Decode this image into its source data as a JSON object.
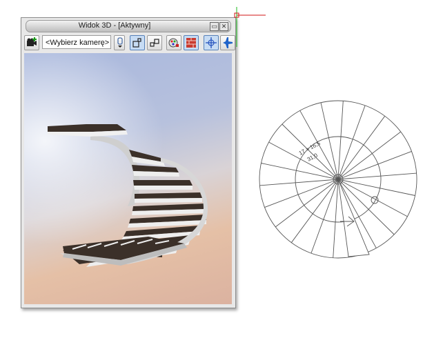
{
  "window": {
    "title": "Widok 3D - [Aktywny]",
    "minimize_glyph": "▭",
    "close_glyph": "✕"
  },
  "toolbar": {
    "camera_placeholder": "<Wybierz kamerę>",
    "icons": [
      "camera-add-icon",
      "camera-dropdown-icon",
      "view-mode-1-icon",
      "view-mode-2-icon",
      "render-settings-icon",
      "texture-icon",
      "orbit-icon",
      "fly-icon"
    ]
  },
  "drawing": {
    "stair_label_1": "17 × 16,5",
    "stair_label_2": "31,0"
  },
  "colors": {
    "tread_dark": "#3b3029",
    "stair_side": "#d9d9d9",
    "axis_red": "#d21414",
    "axis_green": "#18b818",
    "active_tool": "#c7dcf4"
  }
}
